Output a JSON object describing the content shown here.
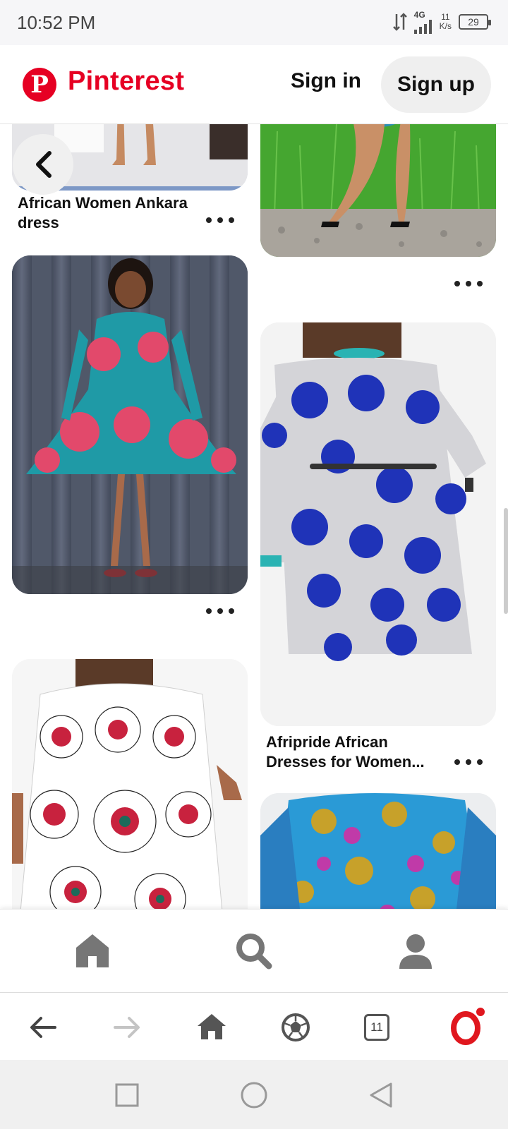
{
  "status_bar": {
    "time": "10:52 PM",
    "network": "4G",
    "speed_value": "11",
    "speed_unit": "K/s",
    "battery": "29"
  },
  "header": {
    "logo_text": "Pinterest",
    "logo_letter": "P",
    "sign_in": "Sign in",
    "sign_up": "Sign up"
  },
  "pins": [
    {
      "title": "African Women Ankara dress"
    },
    {
      "title": ""
    },
    {
      "title": ""
    },
    {
      "title": "Afripride African Dresses for Women..."
    },
    {
      "title": ""
    },
    {
      "title": ""
    }
  ],
  "bottom_nav": {
    "items": [
      "home-icon",
      "search-icon",
      "profile-icon"
    ]
  },
  "browser_bar": {
    "tabs_count": "11",
    "icons": [
      "back-arrow-icon",
      "forward-arrow-icon",
      "home-icon",
      "soccer-ball-icon",
      "tabs-icon",
      "opera-icon"
    ]
  },
  "system_nav": {
    "icons": [
      "recents-square-icon",
      "home-circle-icon",
      "back-triangle-icon"
    ]
  },
  "colors": {
    "brand": "#e60023",
    "pill": "#efefef"
  }
}
